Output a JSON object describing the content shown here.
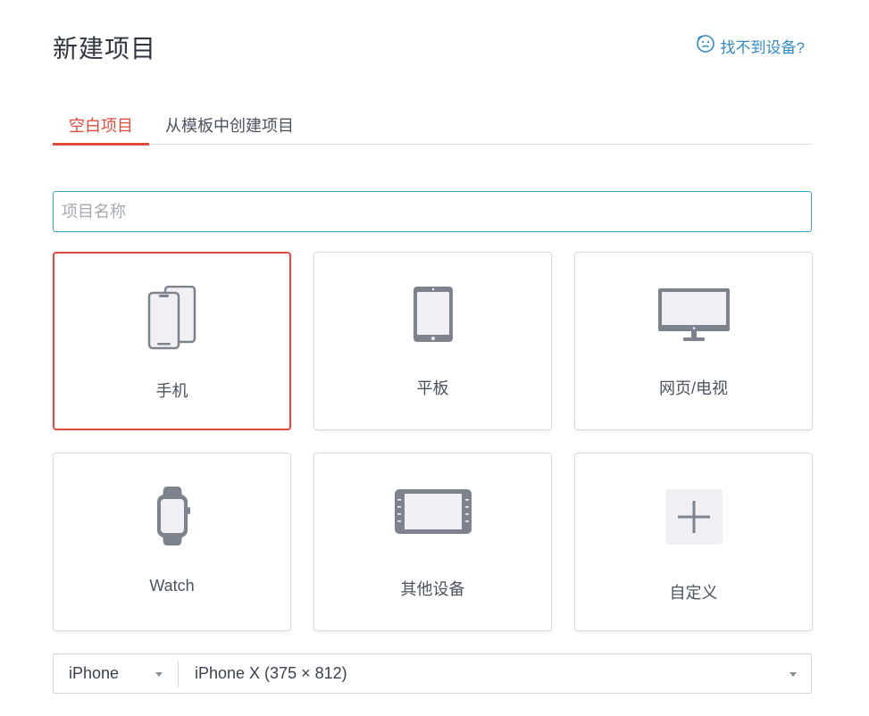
{
  "header": {
    "title": "新建项目",
    "help_link": "找不到设备?"
  },
  "tabs": [
    {
      "label": "空白项目",
      "active": true
    },
    {
      "label": "从模板中创建项目",
      "active": false
    }
  ],
  "name_field": {
    "value": "",
    "placeholder": "项目名称"
  },
  "device_types": [
    {
      "label": "手机",
      "icon": "phone-icon",
      "selected": true
    },
    {
      "label": "平板",
      "icon": "tablet-icon",
      "selected": false
    },
    {
      "label": "网页/电视",
      "icon": "monitor-icon",
      "selected": false
    },
    {
      "label": "Watch",
      "icon": "watch-icon",
      "selected": false
    },
    {
      "label": "其他设备",
      "icon": "other-device-icon",
      "selected": false
    },
    {
      "label": "自定义",
      "icon": "plus-icon",
      "selected": false
    }
  ],
  "selectors": {
    "device": "iPhone",
    "model": "iPhone X (375 × 812)"
  },
  "colors": {
    "accent": "#e14b3b",
    "link": "#2f8ccf",
    "input_focus": "#3ba2d8",
    "icon_gray": "#7d838d"
  }
}
